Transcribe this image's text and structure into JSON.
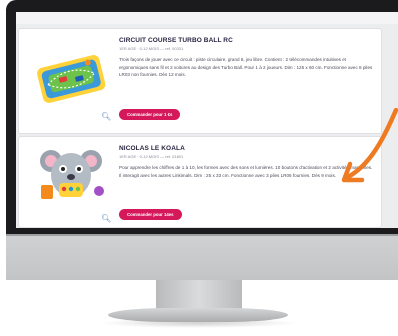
{
  "colors": {
    "bezel": "#1b1b1d",
    "screen_background": "#ecedef",
    "card_background": "#ffffff",
    "accent_button": "#d4185a",
    "zoom_icon": "#4e7fb8",
    "arrow": "#ee7a22"
  },
  "products": [
    {
      "title": "CIRCUIT COURSE TURBO BALL RC",
      "meta": "1ER AGE · 0-12 MOIS — ref. 00331",
      "description": "Trois façons de jouer avec ce circuit : piste circulaire, grand 8, jeu libre. Contient : 2 télécommandes intuitives et ergonomiques sans fil et 2 voitures au design des Turbo Ball. Pour 1 à 2 joueurs. Dim : 125 x 60 cm. Fonctionne avec 8 piles LR03 non fournies. Dès 12 mois.",
      "button_label": "Commander pour 1 €s",
      "zoom_icon": "magnifier-icon"
    },
    {
      "title": "NICOLAS LE KOALA",
      "meta": "1ER AGE · 0-12 MOIS — ref. 01801",
      "description": "Pour apprendre les chiffres de 1 à 10, les formes avec des sons et lumières. 10 boutons d'activation et 2 activités manuelles. Il interagit avec les autres Linkimals. Dim : 25 x 33 cm. Fonctionne avec 3 piles LR06 fournies. Dès 9 mois.",
      "button_label": "Commander pour 14es",
      "zoom_icon": "magnifier-icon"
    }
  ]
}
